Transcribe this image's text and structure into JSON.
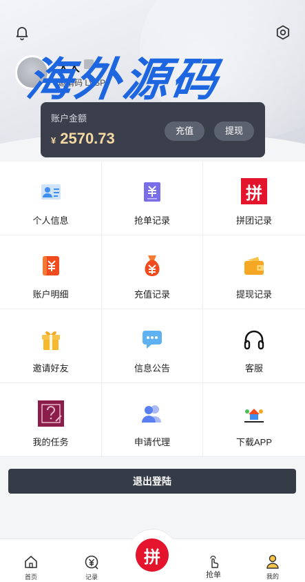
{
  "header": {
    "username": "大大",
    "invite_text": "邀请码 LVSPF",
    "watermark": "海外源码"
  },
  "balance": {
    "label": "账户金额",
    "currency": "¥",
    "amount": "2570.73",
    "recharge_label": "充值",
    "withdraw_label": "提现"
  },
  "menu": [
    {
      "label": "个人信息",
      "icon": "profile-card-icon"
    },
    {
      "label": "抢单记录",
      "icon": "order-record-icon"
    },
    {
      "label": "拼团记录",
      "icon": "group-buy-icon"
    },
    {
      "label": "账户明细",
      "icon": "account-detail-icon"
    },
    {
      "label": "充值记录",
      "icon": "money-bag-icon"
    },
    {
      "label": "提现记录",
      "icon": "wallet-icon"
    },
    {
      "label": "邀请好友",
      "icon": "gift-icon"
    },
    {
      "label": "信息公告",
      "icon": "message-icon"
    },
    {
      "label": "客服",
      "icon": "headphones-icon"
    },
    {
      "label": "我的任务",
      "icon": "task-icon"
    },
    {
      "label": "申请代理",
      "icon": "agent-users-icon"
    },
    {
      "label": "下载APP",
      "icon": "app-logo-icon"
    }
  ],
  "group_icon_text": "拼",
  "logout_label": "退出登陆",
  "tabbar": {
    "home": "首页",
    "records": "记录",
    "center": "拼",
    "grab": "抢单",
    "mine": "我的"
  },
  "colors": {
    "accent_red": "#e3142b",
    "dark_card": "#3a3f4b",
    "amount_gold": "#f7d9a3",
    "logout_bg": "#363b48"
  }
}
